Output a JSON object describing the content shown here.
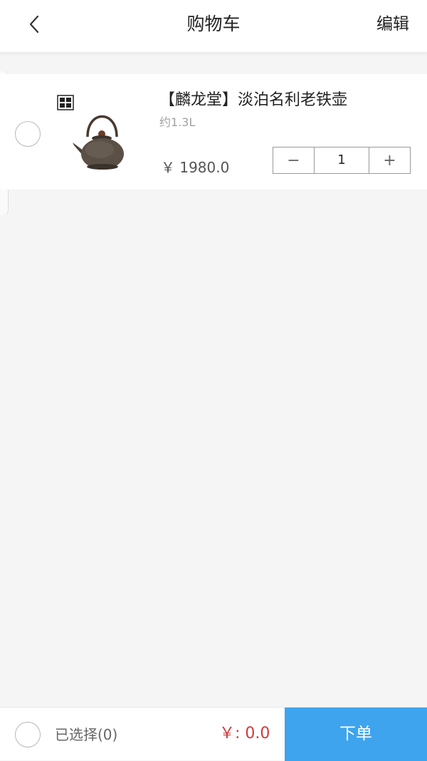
{
  "header": {
    "title": "购物车",
    "edit_label": "编辑"
  },
  "cart": {
    "items": [
      {
        "name": "【麟龙堂】淡泊名利老铁壶",
        "spec": "约1.3L",
        "price": "￥ 1980.0",
        "quantity": "1",
        "minus_symbol": "−",
        "plus_symbol": "+",
        "image_icon": "iron-teapot"
      }
    ]
  },
  "footer": {
    "selected_label": "已选择(0)",
    "total": "￥: 0.0",
    "order_label": "下单"
  },
  "colors": {
    "accent": "#3ea4ee",
    "price_total": "#d23a3a",
    "background": "#f5f5f5"
  }
}
